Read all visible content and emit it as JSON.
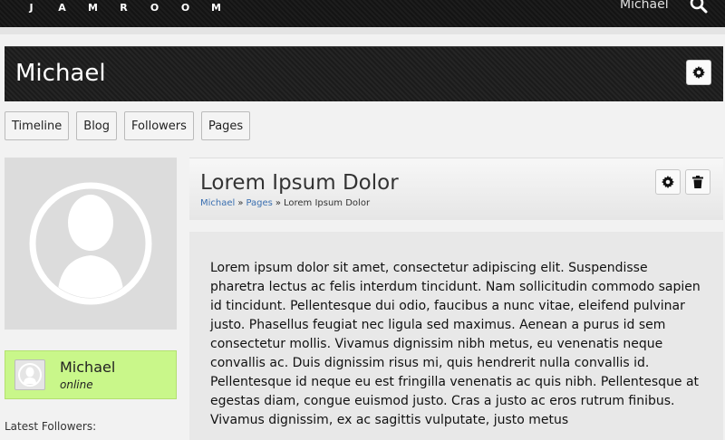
{
  "header": {
    "logo_letters": [
      "J",
      "A",
      "M",
      "R",
      "O",
      "O",
      "M"
    ],
    "user_name": "Michael",
    "search_icon": "search-icon"
  },
  "profile": {
    "title": "Michael",
    "settings_icon": "gear-icon"
  },
  "tabs": [
    {
      "label": "Timeline"
    },
    {
      "label": "Blog"
    },
    {
      "label": "Followers"
    },
    {
      "label": "Pages"
    }
  ],
  "sidebar": {
    "avatar_icon": "user-avatar-icon",
    "online_user": {
      "name": "Michael",
      "status": "online"
    },
    "followers_label": "Latest Followers:"
  },
  "page": {
    "title": "Lorem Ipsum Dolor",
    "breadcrumb": [
      {
        "label": "Michael",
        "link": true
      },
      {
        "label": "»",
        "link": false
      },
      {
        "label": "Pages",
        "link": true
      },
      {
        "label": "»",
        "link": false
      },
      {
        "label": "Lorem Ipsum Dolor",
        "link": false
      }
    ],
    "settings_icon": "gear-icon",
    "delete_icon": "trash-icon",
    "body": "Lorem ipsum dolor sit amet, consectetur adipiscing elit. Suspendisse pharetra lectus ac felis interdum tincidunt. Nam sollicitudin commodo sapien id tincidunt. Pellentesque dui odio, faucibus a nunc vitae, eleifend pulvinar justo. Phasellus feugiat nec ligula sed maximus. Aenean a purus id sem consectetur mollis. Vivamus dignissim nibh metus, eu venenatis neque convallis ac. Duis dignissim risus mi, quis hendrerit nulla convallis id. Pellentesque id neque eu est fringilla venenatis ac quis nibh. Pellentesque at egestas diam, congue euismod justo. Cras a justo ac eros rutrum finibus. Vivamus dignissim, ex ac sagittis vulputate, justo metus"
  },
  "colors": {
    "online_bg": "#c9f78a",
    "link": "#3a6fb0",
    "dark_bar": "#222222"
  }
}
